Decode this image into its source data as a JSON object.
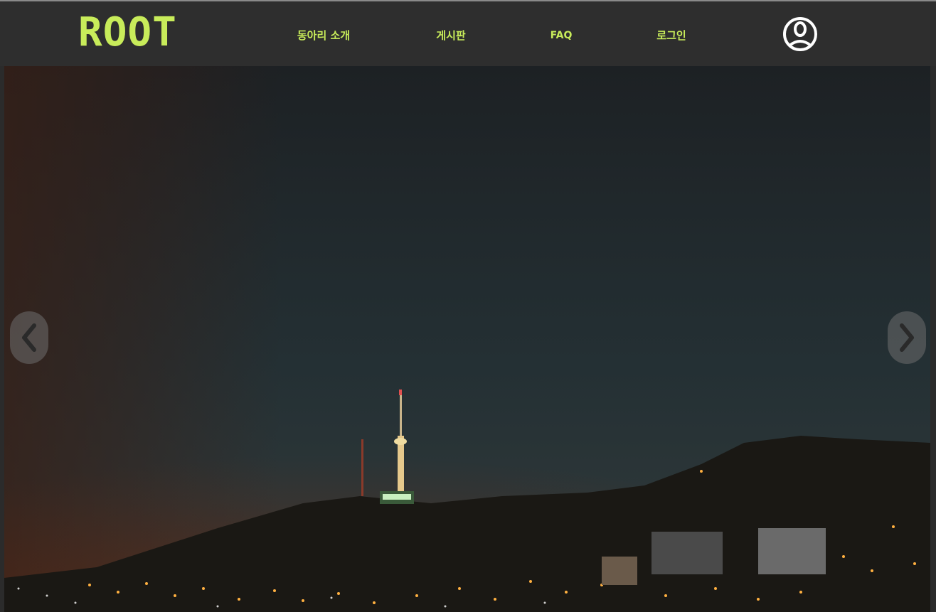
{
  "header": {
    "logo_text": "ROOT",
    "nav": {
      "about": "동아리 소개",
      "board": "게시판",
      "faq": "FAQ",
      "login": "로그인"
    },
    "profile_icon": "user-circle-icon"
  },
  "slider": {
    "prev_icon": "chevron-left-icon",
    "next_icon": "chevron-right-icon",
    "image_description": "night skyline with lit tower on hill"
  },
  "colors": {
    "accent": "#c8ec5a",
    "navbar_bg": "#2e2e2e",
    "sky_top": "#1e2326",
    "arrow_bg": "#6e6e6e"
  }
}
